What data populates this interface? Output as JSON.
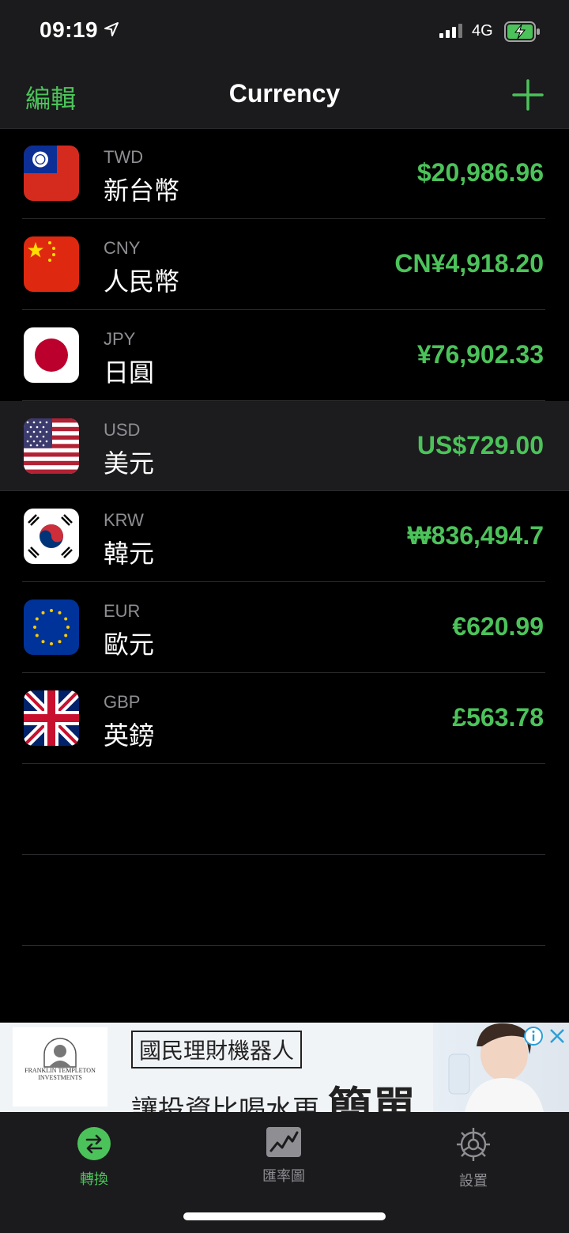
{
  "status": {
    "time": "09:19",
    "network": "4G"
  },
  "nav": {
    "edit_label": "編輯",
    "title": "Currency"
  },
  "currencies": [
    {
      "code": "TWD",
      "name": "新台幣",
      "amount": "$20,986.96"
    },
    {
      "code": "CNY",
      "name": "人民幣",
      "amount": "CN¥4,918.20"
    },
    {
      "code": "JPY",
      "name": "日圓",
      "amount": "¥76,902.33"
    },
    {
      "code": "USD",
      "name": "美元",
      "amount": "US$729.00"
    },
    {
      "code": "KRW",
      "name": "韓元",
      "amount": "₩836,494.7"
    },
    {
      "code": "EUR",
      "name": "歐元",
      "amount": "€620.99"
    },
    {
      "code": "GBP",
      "name": "英鎊",
      "amount": "£563.78"
    }
  ],
  "ad": {
    "box_text": "國民理財機器人",
    "line_text": "讓投資比喝水更",
    "big_text": "簡單",
    "brand": "FRANKLIN TEMPLETON INVESTMENTS"
  },
  "tabs": [
    {
      "label": "轉換"
    },
    {
      "label": "匯率圖"
    },
    {
      "label": "設置"
    }
  ],
  "colors": {
    "accent": "#4cc35a",
    "background": "#000000",
    "bar": "#1b1b1d",
    "selected_row": "#1c1c1e"
  }
}
